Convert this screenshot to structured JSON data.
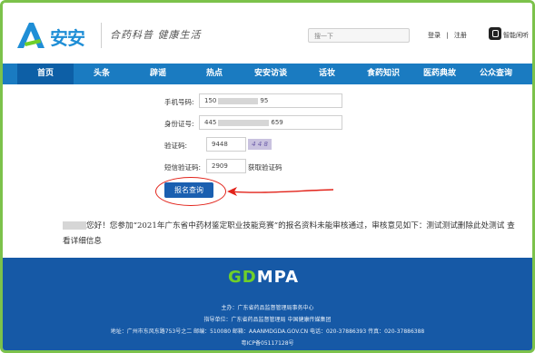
{
  "header": {
    "logo_text": "安安",
    "slogan": "合药科普 健康生活",
    "search_placeholder": "搜一下",
    "login": "登录",
    "separator": "|",
    "register": "注册",
    "speaker_label": "智能闲听"
  },
  "nav": {
    "items": [
      "首页",
      "头条",
      "辟谣",
      "热点",
      "安安访谈",
      "话妆",
      "食药知识",
      "医药典故",
      "公众查询"
    ],
    "active_index": 0
  },
  "form": {
    "phone_label": "手机号码:",
    "phone_value_prefix": "150",
    "phone_value_suffix": "95",
    "id_label": "身份证号:",
    "id_value_prefix": "445",
    "id_value_suffix": "659",
    "captcha_label": "验证码:",
    "captcha_value": "9448",
    "captcha_image_text": "4 4 8",
    "sms_label": "短信验证码:",
    "sms_value": "2909",
    "get_code_label": "获取验证码",
    "query_button": "报名查询"
  },
  "message": {
    "text": "您好！您参加“2021年广东省中药材鉴定职业技能竞赛”的报名资料未能审核通过，审核意见如下：测试测试删除此处测试",
    "link": "查看详细信息"
  },
  "footer": {
    "logo_g": "GD",
    "logo_m": "MPA",
    "line1": "主办：广东省药品监督管理局事务中心",
    "line2": "指导单位：广东省药品监督管理局      中国健康传媒集团",
    "line3": "地址：广州市东风东路753号之二   邮编：510080   邮箱：AAANMDGDA.GOV.CN   电话：020-37886393   传真：020-37886388",
    "line4": "粤ICP备05117128号"
  },
  "colors": {
    "frame": "#7cc24b",
    "nav": "#1a7bc1",
    "nav_active": "#0d5fa6",
    "button": "#1a5fb0",
    "highlight": "#e2231a",
    "footer": "#1659a6"
  }
}
